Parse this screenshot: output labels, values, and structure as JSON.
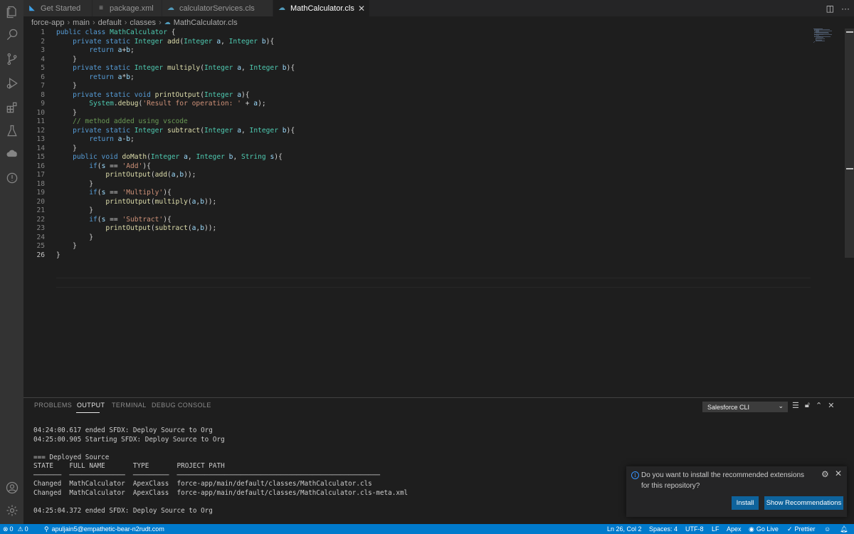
{
  "tabs": [
    {
      "label": "Get Started",
      "icon": "vscode-logo-icon",
      "active": false
    },
    {
      "label": "package.xml",
      "icon": "file-lines-icon",
      "active": false
    },
    {
      "label": "calculatorServices.cls",
      "icon": "salesforce-file-icon",
      "active": false
    },
    {
      "label": "MathCalculator.cls",
      "icon": "salesforce-file-icon",
      "active": true
    }
  ],
  "breadcrumb": [
    "force-app",
    "main",
    "default",
    "classes",
    "MathCalculator.cls"
  ],
  "editor": {
    "line_numbers": [
      "1",
      "2",
      "3",
      "4",
      "5",
      "6",
      "7",
      "8",
      "9",
      "10",
      "11",
      "12",
      "13",
      "14",
      "15",
      "16",
      "17",
      "18",
      "19",
      "20",
      "21",
      "22",
      "23",
      "24",
      "25",
      "26"
    ],
    "lines": [
      "public class MathCalculator {",
      "    private static Integer add(Integer a, Integer b){",
      "        return a+b;",
      "    }",
      "    private static Integer multiply(Integer a, Integer b){",
      "        return a*b;",
      "    }",
      "    private static void printOutput(Integer a){",
      "        System.debug('Result for operation: ' + a);",
      "    }",
      "    // method added using vscode",
      "    private static Integer subtract(Integer a, Integer b){",
      "        return a-b;",
      "    }",
      "    public void doMath(Integer a, Integer b, String s){",
      "        if(s == 'Add'){",
      "            printOutput(add(a,b));",
      "        }",
      "        if(s == 'Multiply'){",
      "            printOutput(multiply(a,b));",
      "        }",
      "        if(s == 'Subtract'){",
      "            printOutput(subtract(a,b));",
      "        }",
      "    }",
      "}"
    ],
    "current_line": 26
  },
  "panel": {
    "tabs": [
      "PROBLEMS",
      "OUTPUT",
      "TERMINAL",
      "DEBUG CONSOLE"
    ],
    "active_tab": "OUTPUT",
    "channel": "Salesforce CLI",
    "output_lines": [
      "04:24:00.617 ended SFDX: Deploy Source to Org",
      "04:25:00.905 Starting SFDX: Deploy Source to Org",
      "",
      "=== Deployed Source",
      "STATE    FULL NAME       TYPE       PROJECT PATH",
      "───────  ──────────────  ─────────  ───────────────────────────────────────────────────",
      "Changed  MathCalculator  ApexClass  force-app/main/default/classes/MathCalculator.cls",
      "Changed  MathCalculator  ApexClass  force-app/main/default/classes/MathCalculator.cls-meta.xml",
      "",
      "04:25:04.372 ended SFDX: Deploy Source to Org"
    ]
  },
  "notification": {
    "message": "Do you want to install the recommended extensions for this repository?",
    "install_label": "Install",
    "show_label": "Show Recommendations"
  },
  "status": {
    "problems": "0",
    "warnings": "0",
    "org": "apuljain5@empathetic-bear-n2rudt.com",
    "position": "Ln 26, Col 2",
    "spaces": "Spaces: 4",
    "encoding": "UTF-8",
    "eol": "LF",
    "language": "Apex",
    "golive": "Go Live",
    "prettier": "Prettier"
  },
  "colors": {
    "status_bar": "#007acc",
    "button": "#0e639c",
    "editor_bg": "#1e1e1e"
  }
}
